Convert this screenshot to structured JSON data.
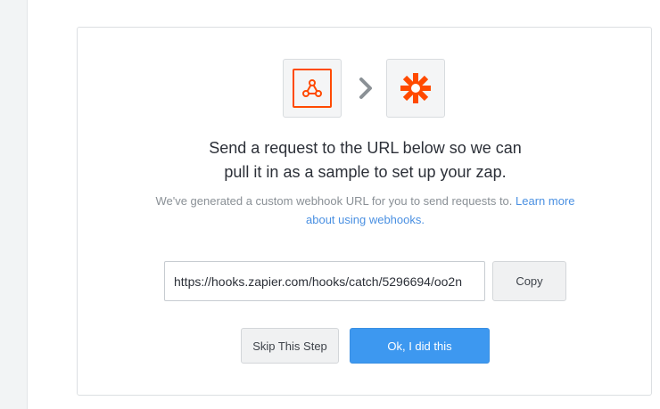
{
  "header": {
    "source_app_icon": "webhook-icon",
    "arrow_icon": "chevron-right-icon",
    "target_app_icon": "zapier-asterisk-icon",
    "brand_color": "#ff4a00"
  },
  "main": {
    "headline_line1": "Send a request to the URL below so we can",
    "headline_line2": "pull it in as a sample to set up your zap.",
    "subtext": "We've generated a custom webhook URL for you to send requests to.",
    "learn_more_link": "Learn more about using webhooks."
  },
  "webhook": {
    "url_value": "https://hooks.zapier.com/hooks/catch/5296694/oo2n",
    "copy_label": "Copy"
  },
  "actions": {
    "skip_label": "Skip This Step",
    "ok_label": "Ok, I did this",
    "primary_color": "#3d98f0"
  }
}
